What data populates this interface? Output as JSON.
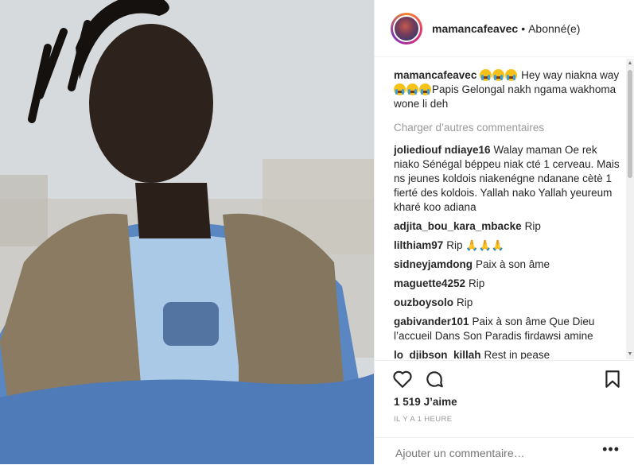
{
  "post": {
    "username": "mamancafeavec",
    "dot": "•",
    "follow_status": "Abonné(e)",
    "caption_text": "Hey way niakna way",
    "caption_text2": "Papis Gelongal nakh ngama wakhoma wone li deh",
    "caption_emoji": "crying-face-emoji",
    "load_more": "Charger d’autres commentaires",
    "likes": "1 519",
    "likes_label": "J’aime",
    "timestamp": "IL Y A 1 HEURE",
    "add_comment_placeholder": "Ajouter un commentaire…",
    "more_options": "•••"
  },
  "comments": [
    {
      "user": "joliediouf ndiaye16",
      "text": "Walay maman Oe rek niako Sénégal béppeu niak cté 1 cerveau. Mais ns jeunes koldois niakenégne ndanane cètè 1 fierté des koldois. Yallah nako Yallah yeureum kharé koo adiana"
    },
    {
      "user": "adjita_bou_kara_mbacke",
      "text": "Rip"
    },
    {
      "user": "lilthiam97",
      "text": "Rip"
    },
    {
      "user": "sidneyjamdong",
      "text": "Paix à son âme"
    },
    {
      "user": "maguette4252",
      "text": "Rip"
    },
    {
      "user": "ouzboysolo",
      "text": "Rip"
    },
    {
      "user": "gabivander101",
      "text": "Paix à son âme Que Dieu l’accueil Dans Son Paradis firdawsi amine"
    },
    {
      "user": "lo_djibson_killah",
      "text": "Rest in pease"
    }
  ],
  "icons": {
    "like": "heart-icon",
    "comment": "comment-icon",
    "save": "bookmark-icon",
    "pray": "folded-hands-emoji"
  },
  "colors": {
    "text": "#262626",
    "muted": "#999999",
    "border": "#efefef"
  }
}
